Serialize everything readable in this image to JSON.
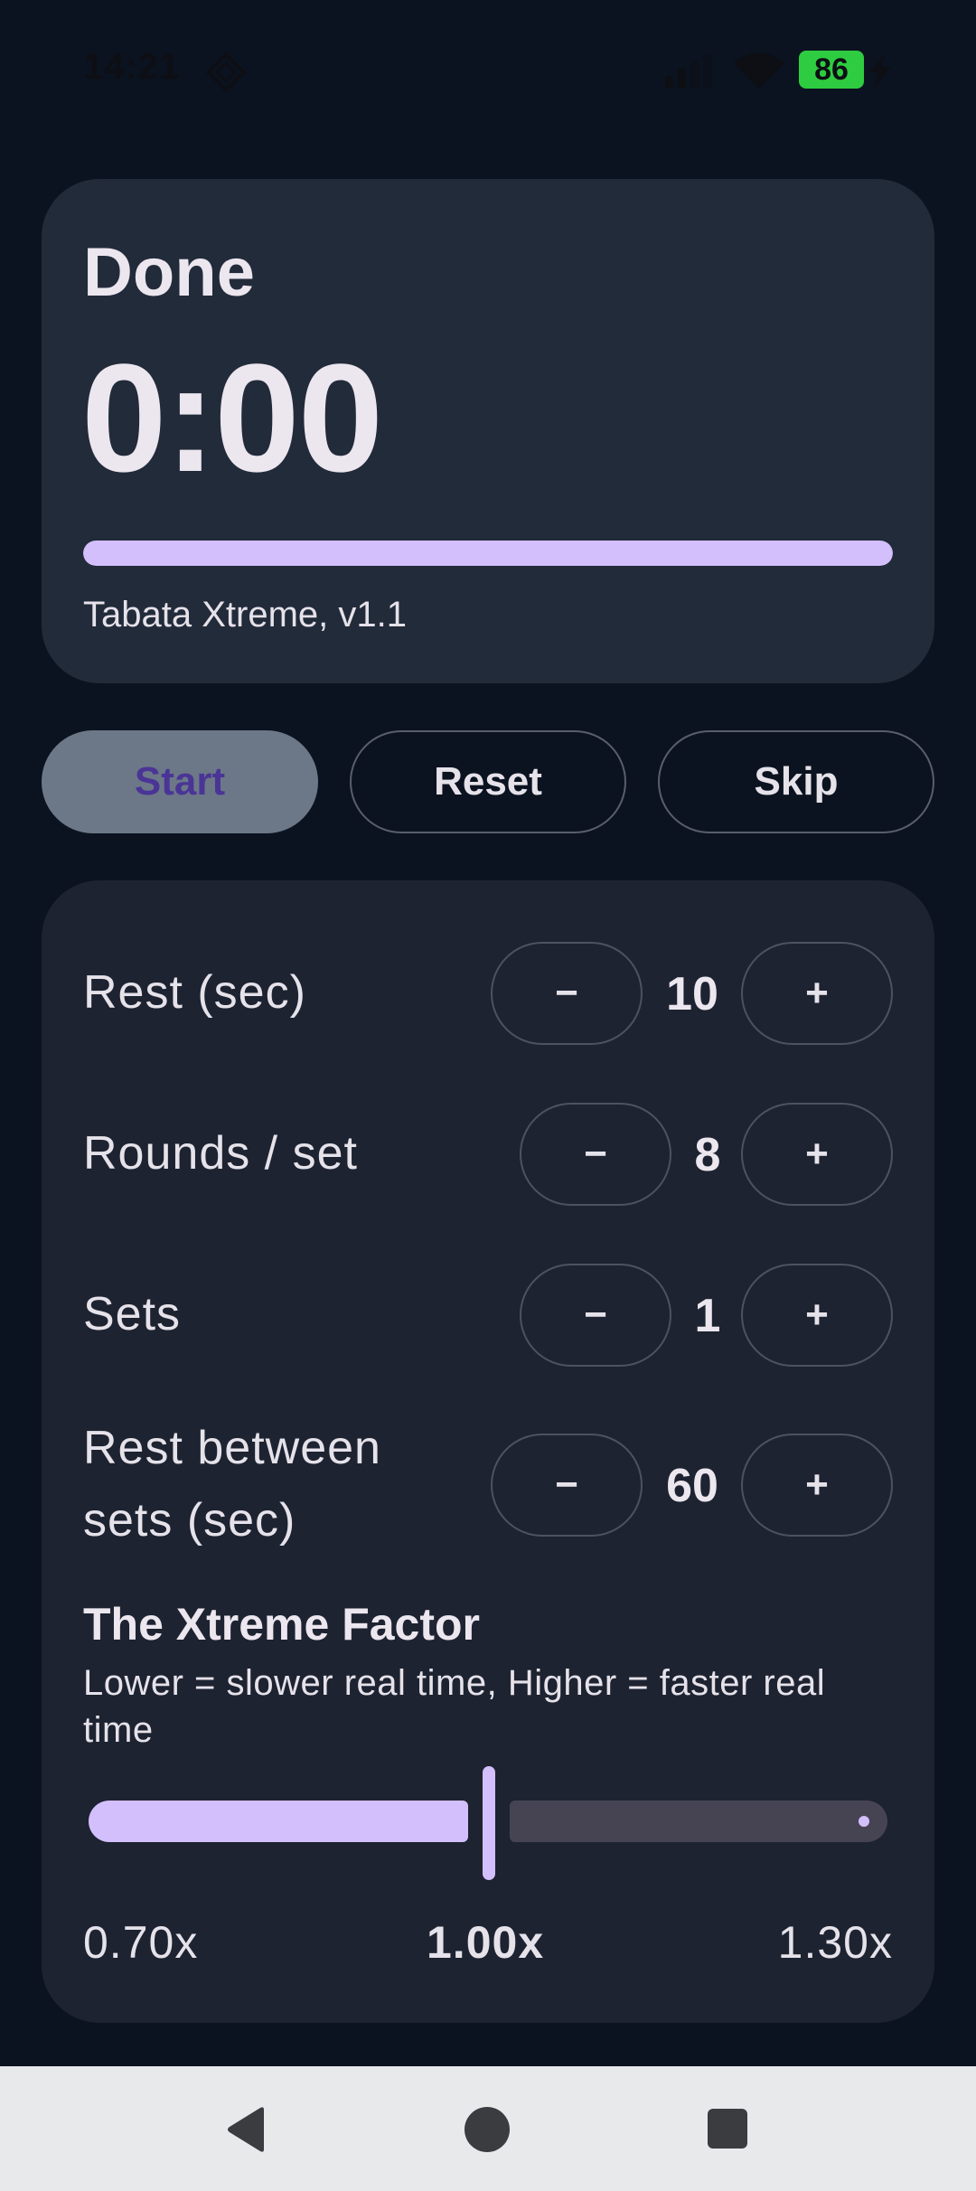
{
  "status_bar": {
    "time": "14:21",
    "battery": "86",
    "icons": [
      "app-notification-icon",
      "signal-icon",
      "wifi-icon",
      "battery-icon",
      "charging-icon"
    ]
  },
  "timer_card": {
    "phase": "Done",
    "time": "0:00",
    "progress": 1.0,
    "version": "Tabata Xtreme, v1.1"
  },
  "controls": {
    "start": "Start",
    "reset": "Reset",
    "skip": "Skip"
  },
  "settings": {
    "rest": {
      "label": "Rest (sec)",
      "value": "10",
      "minus": "−",
      "plus": "+"
    },
    "rounds": {
      "label": "Rounds / set",
      "value": "8",
      "minus": "−",
      "plus": "+"
    },
    "sets": {
      "label": "Sets",
      "value": "1",
      "minus": "−",
      "plus": "+"
    },
    "rest_between": {
      "label_line1": "Rest between",
      "label_line2": "sets (sec)",
      "value": "60",
      "minus": "−",
      "plus": "+"
    }
  },
  "xtreme": {
    "title": "The Xtreme Factor",
    "description": "Lower = slower real time, Higher = faster real time",
    "min_label": "0.70x",
    "current_label": "1.00x",
    "max_label": "1.30x",
    "value": 1.0,
    "min": 0.7,
    "max": 1.3
  },
  "colors": {
    "accent": "#d3bffb",
    "background": "#0b1320",
    "card": "#222b3a"
  },
  "nav": {
    "icons": [
      "back-icon",
      "home-icon",
      "recents-icon"
    ]
  }
}
